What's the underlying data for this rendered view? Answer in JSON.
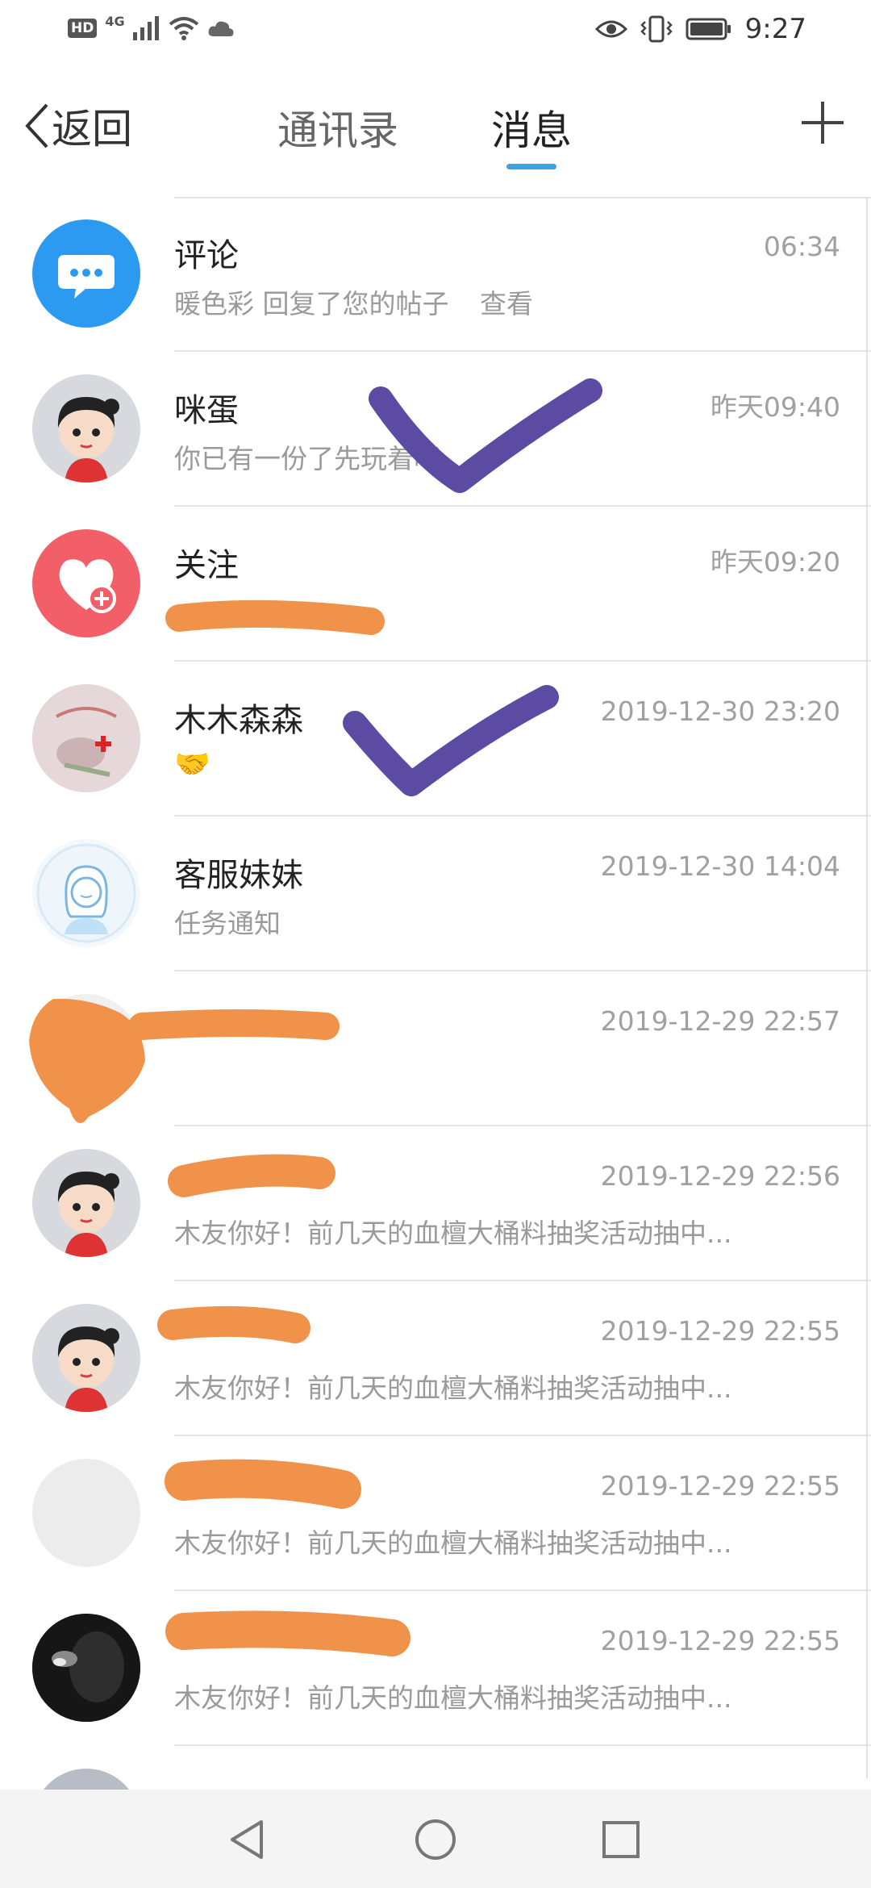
{
  "status_bar": {
    "left_icons": [
      "hd-icon",
      "signal-icon",
      "wifi-icon",
      "cloud-icon"
    ],
    "hd": "HD",
    "network": "4G",
    "right_icons": [
      "eye-icon",
      "vibrate-icon",
      "battery-icon"
    ],
    "time": "9:27"
  },
  "header": {
    "back_label": "返回",
    "tabs": [
      {
        "label": "通讯录",
        "active": false
      },
      {
        "label": "消息",
        "active": true
      }
    ],
    "accent_color": "#3aa3e8"
  },
  "messages": [
    {
      "title": "评论",
      "time": "06:34",
      "preview": "暖色彩 回复了您的帖子",
      "action": "查看",
      "avatar": "chat-bubble-icon"
    },
    {
      "title": "咪蛋",
      "time": "昨天09:40",
      "preview": "你已有一份了先玩着吧",
      "avatar": "cartoon-girl-avatar"
    },
    {
      "title": "关注",
      "time": "昨天09:20",
      "preview": "",
      "avatar": "heart-plus-icon"
    },
    {
      "title": "木木森森",
      "time": "2019-12-30 23:20",
      "preview": "🤝",
      "avatar": "photo-avatar"
    },
    {
      "title": "客服妹妹",
      "time": "2019-12-30 14:04",
      "preview": "任务通知",
      "avatar": "customer-service-avatar"
    },
    {
      "title": "",
      "time": "2019-12-29 22:57",
      "preview": "",
      "avatar": "redacted-avatar"
    },
    {
      "title": "",
      "time": "2019-12-29 22:56",
      "preview": "木友你好！前几天的血檀大桶料抽奖活动抽中...",
      "avatar": "cartoon-girl-avatar"
    },
    {
      "title": "",
      "time": "2019-12-29 22:55",
      "preview": "木友你好！前几天的血檀大桶料抽奖活动抽中...",
      "avatar": "cartoon-girl-avatar"
    },
    {
      "title": "",
      "time": "2019-12-29 22:55",
      "preview": "木友你好！前几天的血檀大桶料抽奖活动抽中...",
      "avatar": "blank-avatar"
    },
    {
      "title": "",
      "time": "2019-12-29 22:55",
      "preview": "木友你好！前几天的血檀大桶料抽奖活动抽中...",
      "avatar": "dark-photo-avatar"
    },
    {
      "title": "",
      "time": "",
      "preview": "",
      "avatar": "partial-avatar"
    }
  ],
  "nav_bar": {
    "icons": [
      "back-triangle-icon",
      "home-circle-icon",
      "recents-square-icon"
    ]
  },
  "colors": {
    "comment_blue": "#2b9af0",
    "follow_red": "#f25f69",
    "redaction_orange": "#f0924a",
    "checkmark_purple": "#5c4ba3"
  }
}
